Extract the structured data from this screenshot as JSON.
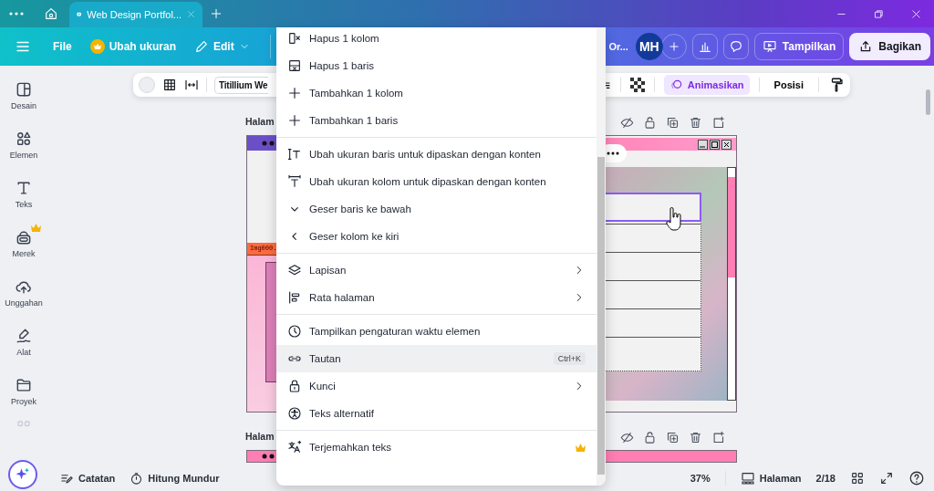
{
  "browser_tabs": [
    {
      "label": "Web Design Portfol...",
      "selected": true
    }
  ],
  "app_bar": {
    "menu": [
      {
        "kind": "file",
        "label": "File"
      },
      {
        "kind": "resize",
        "label": "Ubah ukuran"
      },
      {
        "kind": "edit",
        "label": "Edit"
      }
    ],
    "doc_title": "Or...",
    "avatar": "MH",
    "present": "Tampilkan",
    "share": "Bagikan"
  },
  "sidebar": {
    "items": [
      {
        "kind": "design",
        "label": "Desain",
        "premium": false
      },
      {
        "kind": "elements",
        "label": "Elemen",
        "premium": false
      },
      {
        "kind": "text",
        "label": "Teks",
        "premium": false
      },
      {
        "kind": "brand",
        "label": "Merek",
        "premium": true
      },
      {
        "kind": "upload",
        "label": "Unggahan",
        "premium": false
      },
      {
        "kind": "draw",
        "label": "Alat",
        "premium": false
      },
      {
        "kind": "folder",
        "label": "Proyek",
        "premium": false
      }
    ]
  },
  "format_toolbar": {
    "font": "Titillium We",
    "animate": "Animasikan",
    "position": "Posisi"
  },
  "pages": [
    {
      "label": "Halam",
      "color": "#6a4fc7"
    },
    {
      "label": "Halam",
      "color": "#ff7eb3"
    }
  ],
  "canvas_text": "Img000.",
  "context_menu": {
    "groups": [
      [
        {
          "kind": "col-remove",
          "label": "Hapus 1 kolom",
          "submenu": false,
          "highlighted": false,
          "premium": false
        },
        {
          "kind": "row-remove",
          "label": "Hapus 1 baris",
          "submenu": false,
          "highlighted": false,
          "premium": false
        },
        {
          "kind": "add",
          "label": "Tambahkan 1 kolom",
          "submenu": false,
          "highlighted": false,
          "premium": false
        },
        {
          "kind": "add",
          "label": "Tambahkan 1 baris",
          "submenu": false,
          "highlighted": false,
          "premium": false
        }
      ],
      [
        {
          "kind": "fit-row",
          "label": "Ubah ukuran baris untuk dipaskan dengan konten",
          "submenu": false,
          "highlighted": false,
          "premium": false
        },
        {
          "kind": "fit-col",
          "label": "Ubah ukuran kolom untuk dipaskan dengan konten",
          "submenu": false,
          "highlighted": false,
          "premium": false
        },
        {
          "kind": "move-down",
          "label": "Geser baris ke bawah",
          "submenu": false,
          "highlighted": false,
          "premium": false
        },
        {
          "kind": "move-left",
          "label": "Geser kolom ke kiri",
          "submenu": false,
          "highlighted": false,
          "premium": false
        }
      ],
      [
        {
          "kind": "layers",
          "label": "Lapisan",
          "submenu": true,
          "highlighted": false,
          "premium": false
        },
        {
          "kind": "align",
          "label": "Rata halaman",
          "submenu": true,
          "highlighted": false,
          "premium": false
        }
      ],
      [
        {
          "kind": "timing",
          "label": "Tampilkan pengaturan waktu elemen",
          "submenu": false,
          "highlighted": false,
          "premium": false
        },
        {
          "kind": "link",
          "label": "Tautan",
          "shortcut": "Ctrl+K",
          "submenu": false,
          "highlighted": true,
          "premium": false
        },
        {
          "kind": "lock",
          "label": "Kunci",
          "submenu": true,
          "highlighted": false,
          "premium": false
        },
        {
          "kind": "alt-text",
          "label": "Teks alternatif",
          "submenu": false,
          "highlighted": false,
          "premium": false
        }
      ],
      [
        {
          "kind": "translate",
          "label": "Terjemahkan teks",
          "submenu": false,
          "highlighted": false,
          "premium": true
        }
      ]
    ]
  },
  "bottom_bar": {
    "notes": "Catatan",
    "timer": "Hitung Mundur",
    "zoom": "37%",
    "pages_button": "Halaman",
    "page_count": "2/18"
  }
}
